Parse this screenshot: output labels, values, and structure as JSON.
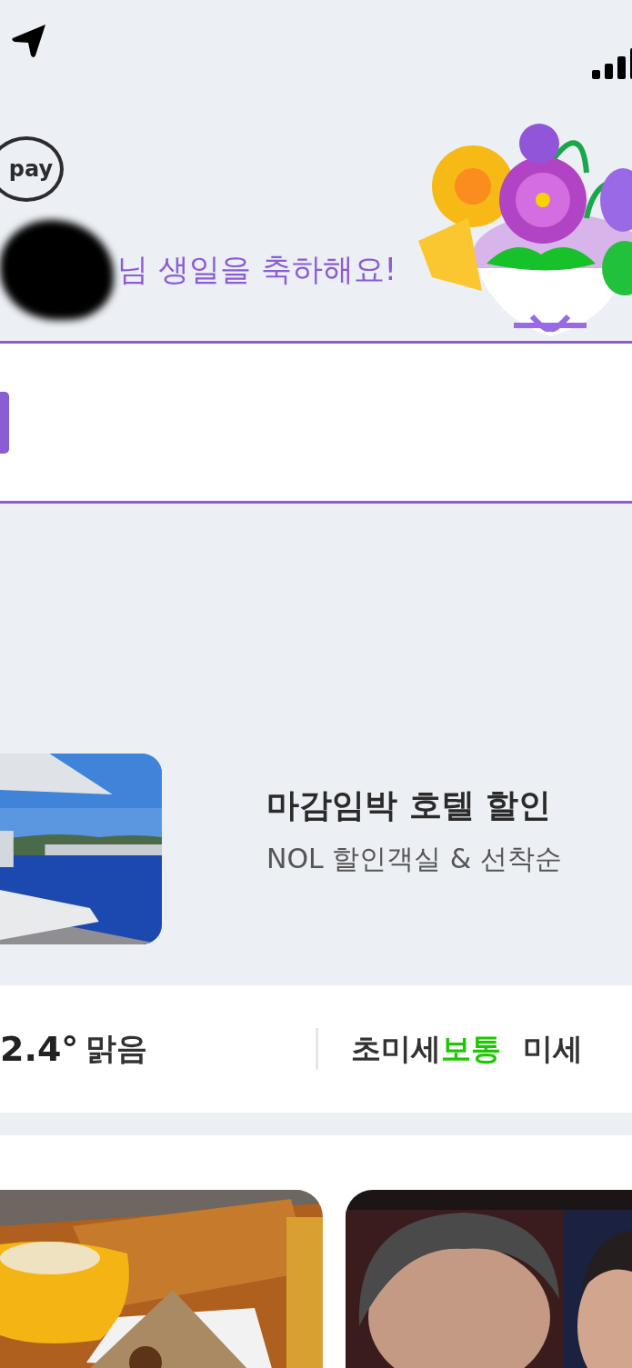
{
  "header": {
    "logo": "pay",
    "greeting": "님 생일을 축하해요!"
  },
  "banner": {
    "title": "마감임박 호텔 할인",
    "subtitle": "NOL 할인객실 & 선착순"
  },
  "weather": {
    "temperature": "2.4°",
    "condition": "맑음",
    "air": [
      {
        "label": "초미세",
        "status": "보통"
      },
      {
        "label": "미세"
      }
    ]
  }
}
